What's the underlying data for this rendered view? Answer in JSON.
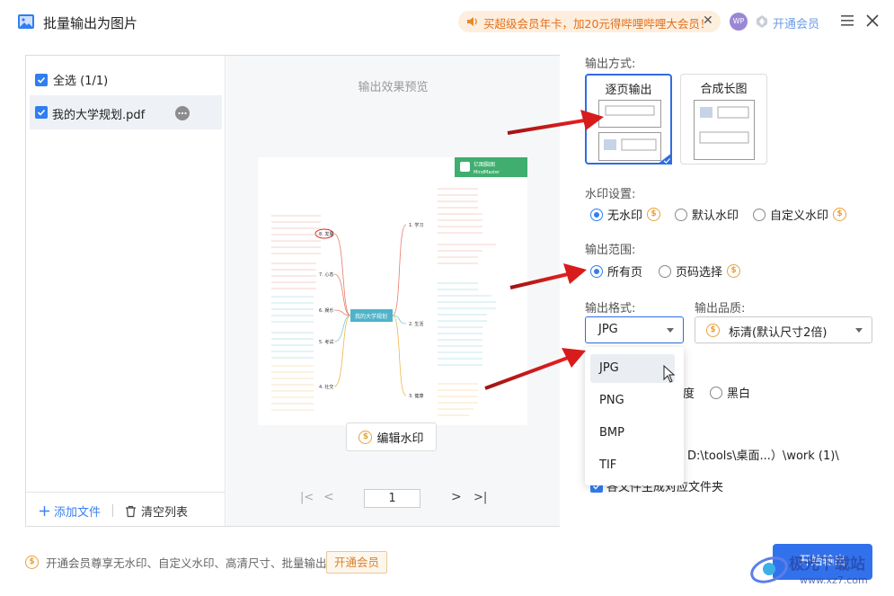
{
  "window": {
    "title": "批量输出为图片"
  },
  "promo": {
    "text": "买超级会员年卡，加20元得哔哩哔哩大会员！"
  },
  "account": {
    "avatar_text": "WP",
    "vip_link": "开通会员"
  },
  "filelist": {
    "select_all": "全选 (1/1)",
    "files": [
      {
        "name": "我的大学规划.pdf"
      }
    ],
    "add_file": "添加文件",
    "clear_list": "清空列表"
  },
  "preview": {
    "title": "输出效果预览",
    "edit_watermark": "编辑水印",
    "page_number": "1"
  },
  "thumbnail": {
    "brand_name": "亿图脑图",
    "brand_sub": "MindMaster",
    "center_topic": "我的大学规划",
    "branches": [
      "1. 学习",
      "2. 生活",
      "3. 健康",
      "4. 社交",
      "5. 考试",
      "6. 娱乐",
      "7. 心态",
      "8. 发展"
    ]
  },
  "settings": {
    "output_mode_label": "输出方式:",
    "mode_per_page": "逐页输出",
    "mode_long_image": "合成长图",
    "watermark_label": "水印设置:",
    "wm_none": "无水印",
    "wm_default": "默认水印",
    "wm_custom": "自定义水印",
    "range_label": "输出范围:",
    "range_all": "所有页",
    "range_select": "页码选择",
    "format_label": "输出格式:",
    "quality_label": "输出品质:",
    "format_value": "JPG",
    "quality_value": "标清(默认尺寸2倍)",
    "color_partial": "度",
    "color_bw": "黑白",
    "path_text": "D:\\tools\\桌面...）\\work (1)\\",
    "folder_option": "各文件生成对应文件夹",
    "format_options": [
      "JPG",
      "PNG",
      "BMP",
      "TIF"
    ]
  },
  "footer": {
    "note": "开通会员尊享无水印、自定义水印、高清尺寸、批量输出",
    "vip_button": "开通会员",
    "export_button": "开始输出"
  },
  "site_watermark": {
    "text": "极光下载站",
    "url": "www.xz7.com"
  }
}
